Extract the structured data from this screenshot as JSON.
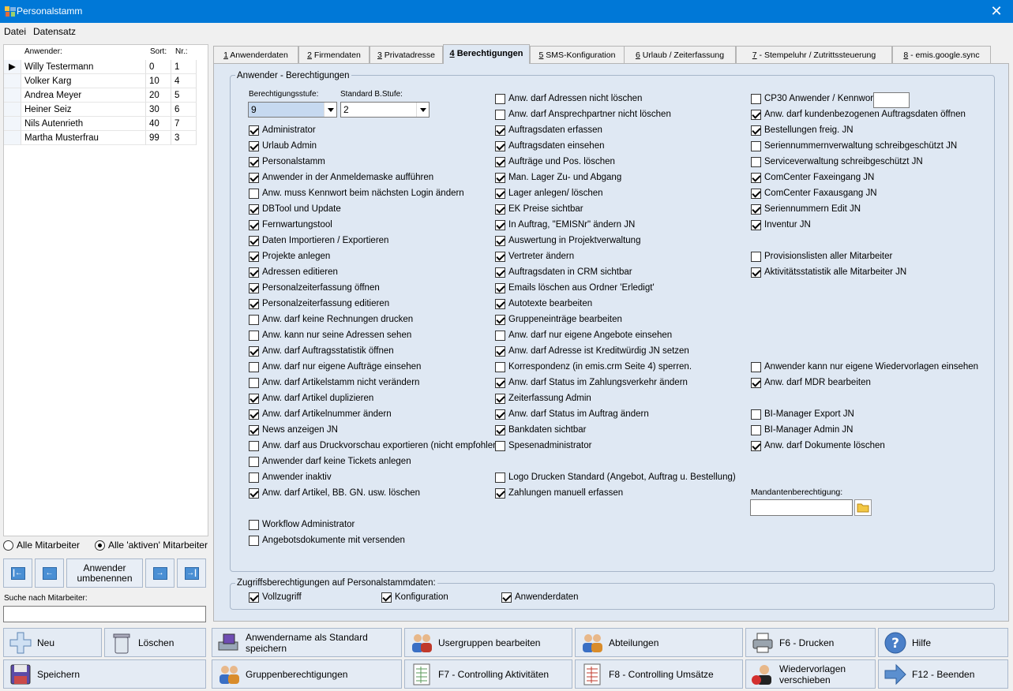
{
  "window": {
    "title": "Personalstamm",
    "close_glyph": "✕"
  },
  "menu": [
    "Datei",
    "Datensatz"
  ],
  "grid": {
    "headers": {
      "name": "Anwender:",
      "sort": "Sort:",
      "nr": "Nr.:"
    },
    "indicator": "▶",
    "rows": [
      {
        "name": "Willy Testermann",
        "sort": "0",
        "nr": "1"
      },
      {
        "name": "Volker Karg",
        "sort": "10",
        "nr": "4"
      },
      {
        "name": "Andrea Meyer",
        "sort": "20",
        "nr": "5"
      },
      {
        "name": "Heiner Seiz",
        "sort": "30",
        "nr": "6"
      },
      {
        "name": "Nils Autenrieth",
        "sort": "40",
        "nr": "7"
      },
      {
        "name": "Martha Musterfrau",
        "sort": "99",
        "nr": "3"
      }
    ]
  },
  "filter": {
    "all": "Alle Mitarbeiter",
    "active": "Alle 'aktiven' Mitarbeiter",
    "selected": "active"
  },
  "nav": {
    "first": "|←",
    "prev": "←",
    "rename": "Anwender umbenennen",
    "next": "→",
    "last": "→|"
  },
  "search": {
    "label": "Suche nach Mitarbeiter:",
    "value": ""
  },
  "tabs": [
    {
      "num": "1",
      "label": " Anwenderdaten",
      "active": false
    },
    {
      "num": "2",
      "label": " Firmendaten",
      "active": false
    },
    {
      "num": "3",
      "label": " Privatadresse",
      "active": false
    },
    {
      "num": "4",
      "label": " Berechtigungen",
      "active": true
    },
    {
      "num": "5",
      "label": " SMS-Konfiguration",
      "active": false
    },
    {
      "num": "6",
      "label": " Urlaub / Zeiterfassung",
      "active": false
    },
    {
      "num": "7",
      "label": " - Stempeluhr / Zutrittssteuerung",
      "active": false
    },
    {
      "num": "8",
      "label": " - emis.google.sync",
      "active": false
    }
  ],
  "perm": {
    "group_title": "Anwender - Berechtigungen",
    "stufe_label": "Berechtigungsstufe:",
    "stufe_value": "9",
    "std_label": "Standard B.Stufe:",
    "std_value": "2",
    "cp30_label": "CP30 Anwender / Kennwort",
    "mandant_label": "Mandantenberechtigung:",
    "col1": [
      {
        "label": "Administrator",
        "checked": true
      },
      {
        "label": "Urlaub Admin",
        "checked": true
      },
      {
        "label": "Personalstamm",
        "checked": true
      },
      {
        "label": "Anwender in der Anmeldemaske aufführen",
        "checked": true
      },
      {
        "label": "Anw. muss Kennwort beim nächsten Login ändern",
        "checked": false
      },
      {
        "label": "DBTool und Update",
        "checked": true
      },
      {
        "label": "Fernwartungstool",
        "checked": true
      },
      {
        "label": "Daten Importieren /  Exportieren",
        "checked": true
      },
      {
        "label": "Projekte anlegen",
        "checked": true
      },
      {
        "label": "Adressen editieren",
        "checked": true
      },
      {
        "label": "Personalzeiterfassung öffnen",
        "checked": true
      },
      {
        "label": "Personalzeiterfassung editieren",
        "checked": true
      },
      {
        "label": "Anw. darf keine Rechnungen drucken",
        "checked": false
      },
      {
        "label": "Anw. kann nur seine Adressen sehen",
        "checked": false
      },
      {
        "label": "Anw. darf Auftragsstatistik öffnen",
        "checked": true
      },
      {
        "label": "Anw. darf nur eigene Aufträge einsehen",
        "checked": false
      },
      {
        "label": "Anw. darf Artikelstamm nicht verändern",
        "checked": false
      },
      {
        "label": "Anw. darf Artikel duplizieren",
        "checked": true
      },
      {
        "label": "Anw. darf Artikelnummer ändern",
        "checked": true
      },
      {
        "label": "News anzeigen JN",
        "checked": true
      },
      {
        "label": "Anw. darf aus Druckvorschau exportieren (nicht empfohlen)",
        "checked": false
      },
      {
        "label": "Anwender darf keine Tickets anlegen",
        "checked": false
      },
      {
        "label": "Anwender inaktiv",
        "checked": false
      },
      {
        "label": "Anw. darf Artikel, BB. GN. usw. löschen",
        "checked": true
      },
      {
        "label": "",
        "checked": null
      },
      {
        "label": "Workflow Administrator",
        "checked": false
      },
      {
        "label": "Angebotsdokumente mit versenden",
        "checked": false
      }
    ],
    "col2": [
      {
        "label": "Anw. darf Adressen nicht löschen",
        "checked": false
      },
      {
        "label": "Anw. darf Ansprechpartner nicht löschen",
        "checked": false
      },
      {
        "label": "Auftragsdaten erfassen",
        "checked": true
      },
      {
        "label": "Auftragsdaten einsehen",
        "checked": true
      },
      {
        "label": "Aufträge und Pos. löschen",
        "checked": true
      },
      {
        "label": "Man. Lager Zu- und Abgang",
        "checked": true
      },
      {
        "label": "Lager anlegen/ löschen",
        "checked": true
      },
      {
        "label": "EK Preise sichtbar",
        "checked": true
      },
      {
        "label": "In Auftrag, \"EMISNr\" ändern JN",
        "checked": true
      },
      {
        "label": "Auswertung in Projektverwaltung",
        "checked": true
      },
      {
        "label": "Vertreter ändern",
        "checked": true
      },
      {
        "label": "Auftragsdaten in CRM sichtbar",
        "checked": true
      },
      {
        "label": "Emails löschen aus Ordner 'Erledigt'",
        "checked": true
      },
      {
        "label": "Autotexte bearbeiten",
        "checked": true
      },
      {
        "label": "Gruppeneinträge bearbeiten",
        "checked": true
      },
      {
        "label": "Anw. darf nur eigene Angebote einsehen",
        "checked": false
      },
      {
        "label": "Anw. darf Adresse ist Kreditwürdig JN setzen",
        "checked": true
      },
      {
        "label": "Korrespondenz (in emis.crm Seite 4) sperren.",
        "checked": false
      },
      {
        "label": "Anw. darf Status im Zahlungsverkehr ändern",
        "checked": true
      },
      {
        "label": "Zeiterfassung Admin",
        "checked": true
      },
      {
        "label": "Anw. darf Status im Auftrag ändern",
        "checked": true
      },
      {
        "label": "Bankdaten sichtbar",
        "checked": true
      },
      {
        "label": "Spesenadministrator",
        "checked": false
      },
      {
        "label": "",
        "checked": null
      },
      {
        "label": "Logo Drucken Standard (Angebot, Auftrag u. Bestellung)",
        "checked": false
      },
      {
        "label": "Zahlungen manuell erfassen",
        "checked": true
      }
    ],
    "col3": [
      {
        "label": "CP30 Anwender / Kennwort",
        "checked": false
      },
      {
        "label": "Anw. darf kundenbezogenen Auftragsdaten öffnen",
        "checked": true
      },
      {
        "label": "Bestellungen freig. JN",
        "checked": true
      },
      {
        "label": "Seriennummernverwaltung schreibgeschützt JN",
        "checked": false
      },
      {
        "label": "Serviceverwaltung schreibgeschützt JN",
        "checked": false
      },
      {
        "label": "ComCenter Faxeingang JN",
        "checked": true
      },
      {
        "label": "ComCenter Faxausgang JN",
        "checked": true
      },
      {
        "label": "Seriennummern Edit JN",
        "checked": true
      },
      {
        "label": "Inventur JN",
        "checked": true
      },
      {
        "label": "",
        "checked": null
      },
      {
        "label": "Provisionslisten aller Mitarbeiter",
        "checked": false
      },
      {
        "label": "Aktivitätsstatistik alle Mitarbeiter JN",
        "checked": true
      },
      {
        "label": "",
        "checked": null
      },
      {
        "label": "",
        "checked": null
      },
      {
        "label": "",
        "checked": null
      },
      {
        "label": "",
        "checked": null
      },
      {
        "label": "",
        "checked": null
      },
      {
        "label": "Anwender kann nur eigene Wiedervorlagen einsehen",
        "checked": false
      },
      {
        "label": "Anw. darf MDR bearbeiten",
        "checked": true
      },
      {
        "label": "",
        "checked": null
      },
      {
        "label": "BI-Manager Export JN",
        "checked": false
      },
      {
        "label": "BI-Manager Admin JN",
        "checked": false
      },
      {
        "label": "Anw. darf Dokumente löschen",
        "checked": true
      }
    ]
  },
  "zugriff": {
    "title": "Zugriffsberechtigungen auf Personalstammdaten:",
    "items": [
      {
        "label": "Vollzugriff",
        "checked": true
      },
      {
        "label": "Konfiguration",
        "checked": true
      },
      {
        "label": "Anwenderdaten",
        "checked": true
      }
    ]
  },
  "buttons": {
    "neu": "Neu",
    "loeschen": "Löschen",
    "standard": "Anwendername als Standard speichern",
    "usergruppen": "Usergruppen bearbeiten",
    "abteilungen": "Abteilungen",
    "drucken": "F6 - Drucken",
    "hilfe": "Hilfe",
    "speichern": "Speichern",
    "gruppenber": "Gruppenberechtigungen",
    "f7": "F7 - Controlling Aktivitäten",
    "f8": "F8 - Controlling Umsätze",
    "wiedervorlagen": "Wiedervorlagen verschieben",
    "beenden": "F12 - Beenden"
  },
  "colors": {
    "accent": "#0078d7",
    "panel": "#dfe8f3",
    "button": "#e4ebf4"
  }
}
